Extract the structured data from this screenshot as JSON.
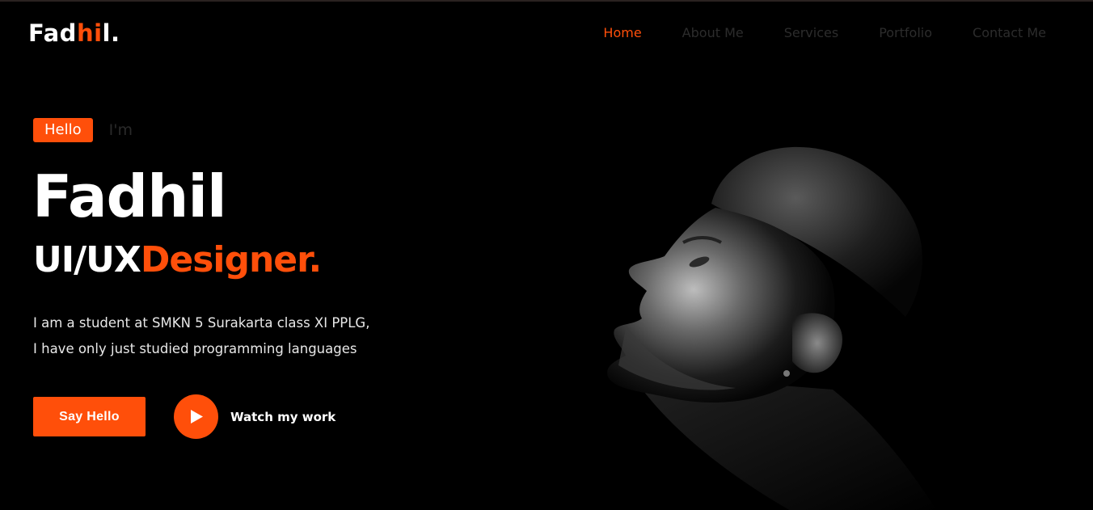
{
  "header": {
    "logo_part1": "Fad",
    "logo_accent": "hi",
    "logo_part2": "l.",
    "nav": [
      {
        "label": "Home",
        "active": true
      },
      {
        "label": "About Me",
        "active": false
      },
      {
        "label": "Services",
        "active": false
      },
      {
        "label": "Portfolio",
        "active": false
      },
      {
        "label": "Contact Me",
        "active": false
      }
    ]
  },
  "hero": {
    "hello_badge": "Hello",
    "im_text": "I'm",
    "name": "Fadhil",
    "role_part1": "UI/UX",
    "role_part2": "Designer.",
    "desc_line1": "I am a student at SMKN 5 Surakarta class XI PPLG,",
    "desc_line2": "I have only just studied programming languages",
    "primary_button": "Say Hello",
    "watch_label": "Watch my work"
  },
  "icons": {
    "play": "play-icon"
  },
  "colors": {
    "accent": "#ff4f0a",
    "background": "#000000",
    "nav_inactive": "#2c2c2c"
  }
}
